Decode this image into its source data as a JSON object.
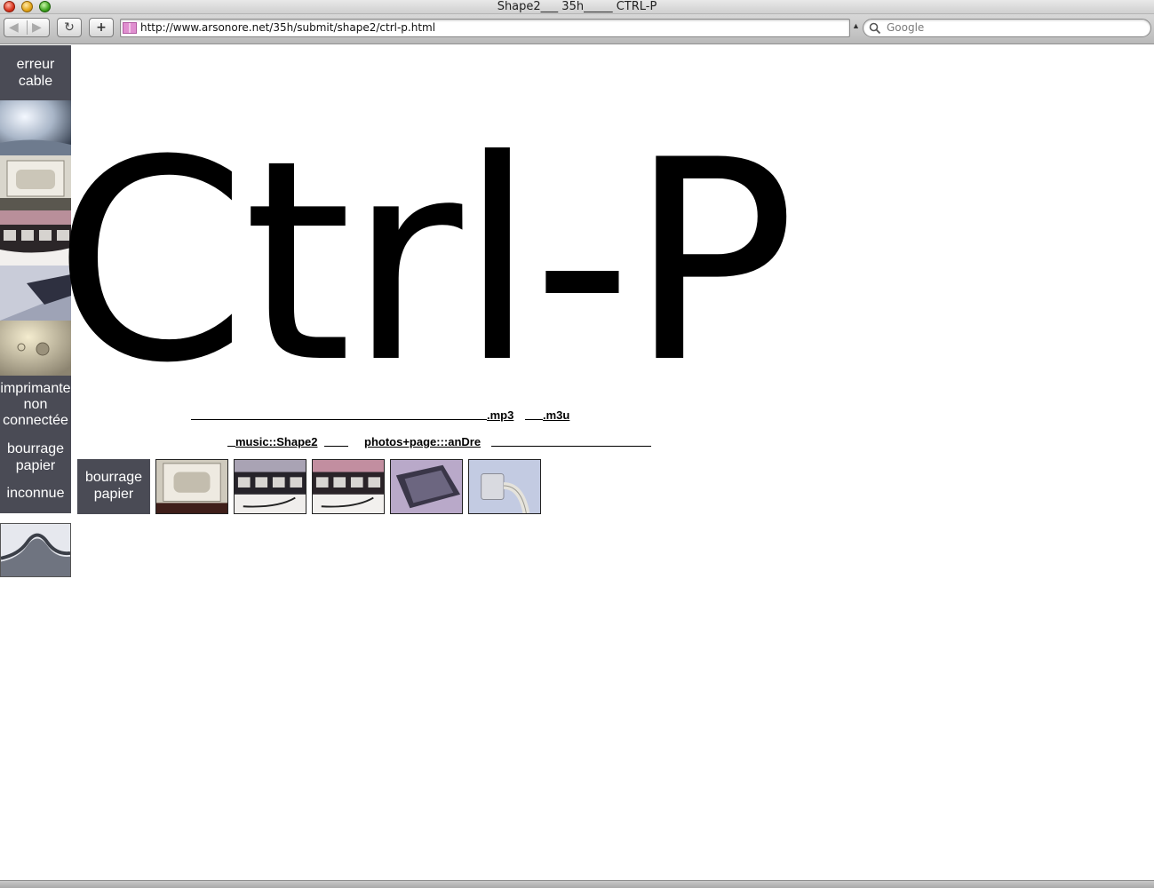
{
  "window": {
    "title": "Shape2___ 35h_____ CTRL-P"
  },
  "toolbar": {
    "back_glyph": "◀",
    "forward_glyph": "▶",
    "reload_glyph": "↻",
    "add_glyph": "+",
    "url": "http://www.arsonore.net/35h/submit/shape2/ctrl-p.html",
    "search_placeholder": "Google"
  },
  "sidebar": {
    "erreur_cable": "erreur cable",
    "imprimante": "imprimante non connectée",
    "bourrage": "bourrage papier",
    "inconnue": "inconnue"
  },
  "headline": "Ctrl-P",
  "links": {
    "mp3": ".mp3",
    "m3u": ".m3u",
    "music": "music::Shape2",
    "photos": "photos+page:::anDre"
  },
  "thumb_row": {
    "bourrage": "bourrage papier"
  },
  "colors": {
    "panel": "#4a4b55",
    "text": "#000000",
    "background": "#ffffff"
  }
}
